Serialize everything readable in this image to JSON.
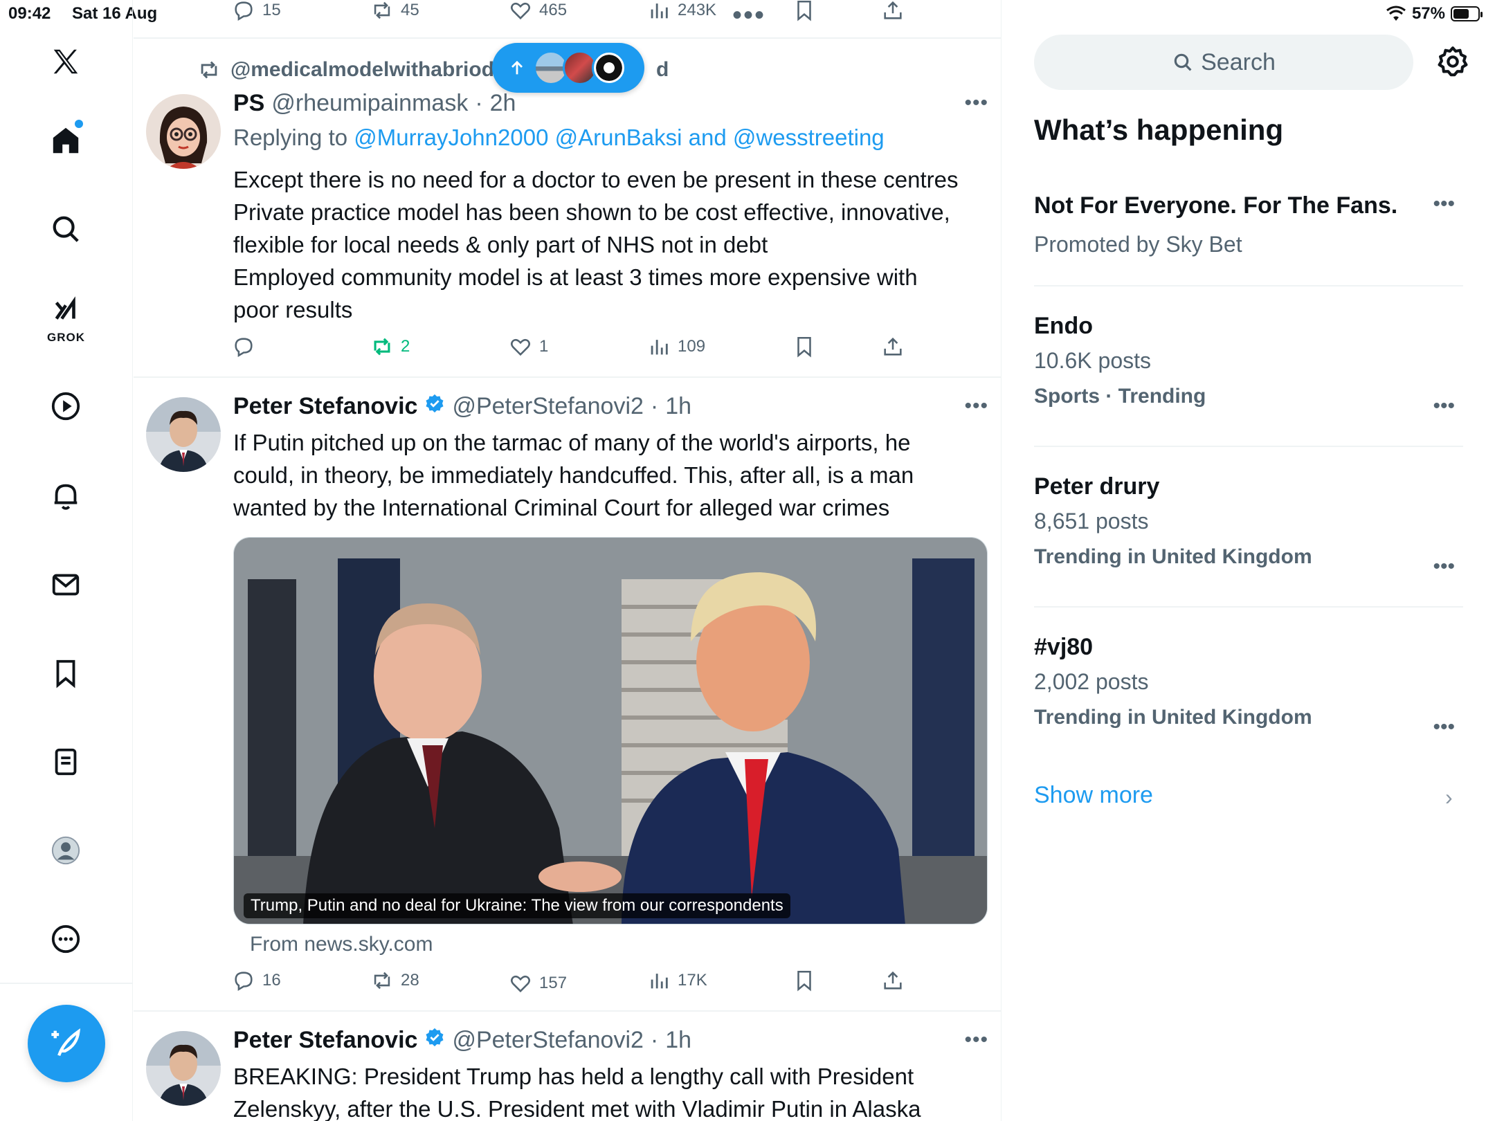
{
  "status_bar": {
    "time": "09:42",
    "date": "Sat 16 Aug",
    "battery": "57%",
    "battery_level": 0.57
  },
  "nav": {
    "items": [
      "x-logo",
      "home",
      "search",
      "grok",
      "videos",
      "notifications",
      "messages",
      "bookmarks",
      "lists",
      "profile",
      "more"
    ],
    "grok_label": "GROK"
  },
  "feed": {
    "top_actions": {
      "replies": "15",
      "reposts": "45",
      "likes": "465",
      "views": "243K"
    },
    "retweet_context": "@medicalmodelwithabriod",
    "retweet_context_tail": "d",
    "tweets": [
      {
        "name": "PS",
        "handle": "@rheumipainmask",
        "time": "2h",
        "reply_prefix": "Replying to",
        "reply_users": "@MurrayJohn2000 @ArunBaksi and @wesstreeting",
        "lines": [
          "Except there is no need for a doctor to even be present in these centres",
          "Private practice model has been shown to be cost effective, innovative,",
          "flexible for local needs & only part of NHS not in debt",
          "Employed community model is at least 3 times more expensive with",
          "poor results"
        ],
        "actions": {
          "replies": "",
          "reposts": "2",
          "likes": "1",
          "views": "109"
        }
      },
      {
        "name": "Peter Stefanovic",
        "handle": "@PeterStefanovi2",
        "time": "1h",
        "lines": [
          "If Putin pitched up on the tarmac of many of the world's airports, he",
          "could, in theory, be immediately handcuffed. This, after all, is a man",
          "wanted by the International Criminal Court for alleged war crimes"
        ],
        "card_caption": "Trump, Putin and no deal for Ukraine: The view from our correspondents",
        "card_from": "From news.sky.com",
        "actions": {
          "replies": "16",
          "reposts": "28",
          "likes": "157",
          "views": "17K"
        }
      },
      {
        "name": "Peter Stefanovic",
        "handle": "@PeterStefanovi2",
        "time": "1h",
        "lines": [
          "BREAKING: President Trump has held a lengthy call with President",
          "Zelenskyy, after the U.S. President met with Vladimir Putin in Alaska"
        ]
      }
    ]
  },
  "sidebar": {
    "search_placeholder": "Search",
    "title": "What’s happening",
    "trends": [
      {
        "title": "Not For Everyone. For The Fans.",
        "sub": "Promoted by Sky Bet",
        "meta": ""
      },
      {
        "title": "Endo",
        "sub": "10.6K posts",
        "meta": "Sports · Trending"
      },
      {
        "title": "Peter drury",
        "sub": "8,651 posts",
        "meta": "Trending in United Kingdom"
      },
      {
        "title": "#vj80",
        "sub": "2,002 posts",
        "meta": "Trending in United Kingdom"
      }
    ],
    "show_more": "Show more"
  },
  "colors": {
    "accent": "#1d9bf0",
    "repost_active": "#00ba7c",
    "muted": "#536471"
  }
}
